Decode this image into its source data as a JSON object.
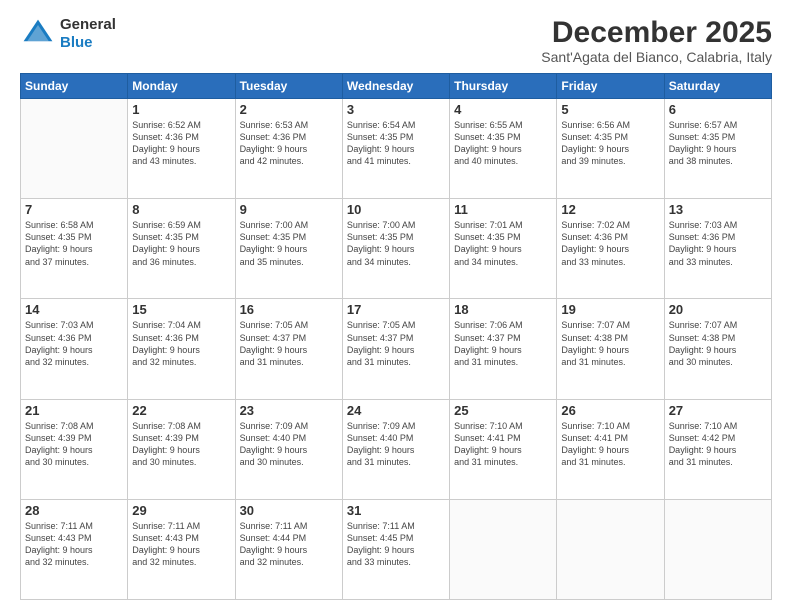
{
  "header": {
    "logo_line1": "General",
    "logo_line2": "Blue",
    "title": "December 2025",
    "subtitle": "Sant'Agata del Bianco, Calabria, Italy"
  },
  "days_of_week": [
    "Sunday",
    "Monday",
    "Tuesday",
    "Wednesday",
    "Thursday",
    "Friday",
    "Saturday"
  ],
  "weeks": [
    [
      {
        "day": "",
        "info": ""
      },
      {
        "day": "1",
        "info": "Sunrise: 6:52 AM\nSunset: 4:36 PM\nDaylight: 9 hours\nand 43 minutes."
      },
      {
        "day": "2",
        "info": "Sunrise: 6:53 AM\nSunset: 4:36 PM\nDaylight: 9 hours\nand 42 minutes."
      },
      {
        "day": "3",
        "info": "Sunrise: 6:54 AM\nSunset: 4:35 PM\nDaylight: 9 hours\nand 41 minutes."
      },
      {
        "day": "4",
        "info": "Sunrise: 6:55 AM\nSunset: 4:35 PM\nDaylight: 9 hours\nand 40 minutes."
      },
      {
        "day": "5",
        "info": "Sunrise: 6:56 AM\nSunset: 4:35 PM\nDaylight: 9 hours\nand 39 minutes."
      },
      {
        "day": "6",
        "info": "Sunrise: 6:57 AM\nSunset: 4:35 PM\nDaylight: 9 hours\nand 38 minutes."
      }
    ],
    [
      {
        "day": "7",
        "info": "Sunrise: 6:58 AM\nSunset: 4:35 PM\nDaylight: 9 hours\nand 37 minutes."
      },
      {
        "day": "8",
        "info": "Sunrise: 6:59 AM\nSunset: 4:35 PM\nDaylight: 9 hours\nand 36 minutes."
      },
      {
        "day": "9",
        "info": "Sunrise: 7:00 AM\nSunset: 4:35 PM\nDaylight: 9 hours\nand 35 minutes."
      },
      {
        "day": "10",
        "info": "Sunrise: 7:00 AM\nSunset: 4:35 PM\nDaylight: 9 hours\nand 34 minutes."
      },
      {
        "day": "11",
        "info": "Sunrise: 7:01 AM\nSunset: 4:35 PM\nDaylight: 9 hours\nand 34 minutes."
      },
      {
        "day": "12",
        "info": "Sunrise: 7:02 AM\nSunset: 4:36 PM\nDaylight: 9 hours\nand 33 minutes."
      },
      {
        "day": "13",
        "info": "Sunrise: 7:03 AM\nSunset: 4:36 PM\nDaylight: 9 hours\nand 33 minutes."
      }
    ],
    [
      {
        "day": "14",
        "info": "Sunrise: 7:03 AM\nSunset: 4:36 PM\nDaylight: 9 hours\nand 32 minutes."
      },
      {
        "day": "15",
        "info": "Sunrise: 7:04 AM\nSunset: 4:36 PM\nDaylight: 9 hours\nand 32 minutes."
      },
      {
        "day": "16",
        "info": "Sunrise: 7:05 AM\nSunset: 4:37 PM\nDaylight: 9 hours\nand 31 minutes."
      },
      {
        "day": "17",
        "info": "Sunrise: 7:05 AM\nSunset: 4:37 PM\nDaylight: 9 hours\nand 31 minutes."
      },
      {
        "day": "18",
        "info": "Sunrise: 7:06 AM\nSunset: 4:37 PM\nDaylight: 9 hours\nand 31 minutes."
      },
      {
        "day": "19",
        "info": "Sunrise: 7:07 AM\nSunset: 4:38 PM\nDaylight: 9 hours\nand 31 minutes."
      },
      {
        "day": "20",
        "info": "Sunrise: 7:07 AM\nSunset: 4:38 PM\nDaylight: 9 hours\nand 30 minutes."
      }
    ],
    [
      {
        "day": "21",
        "info": "Sunrise: 7:08 AM\nSunset: 4:39 PM\nDaylight: 9 hours\nand 30 minutes."
      },
      {
        "day": "22",
        "info": "Sunrise: 7:08 AM\nSunset: 4:39 PM\nDaylight: 9 hours\nand 30 minutes."
      },
      {
        "day": "23",
        "info": "Sunrise: 7:09 AM\nSunset: 4:40 PM\nDaylight: 9 hours\nand 30 minutes."
      },
      {
        "day": "24",
        "info": "Sunrise: 7:09 AM\nSunset: 4:40 PM\nDaylight: 9 hours\nand 31 minutes."
      },
      {
        "day": "25",
        "info": "Sunrise: 7:10 AM\nSunset: 4:41 PM\nDaylight: 9 hours\nand 31 minutes."
      },
      {
        "day": "26",
        "info": "Sunrise: 7:10 AM\nSunset: 4:41 PM\nDaylight: 9 hours\nand 31 minutes."
      },
      {
        "day": "27",
        "info": "Sunrise: 7:10 AM\nSunset: 4:42 PM\nDaylight: 9 hours\nand 31 minutes."
      }
    ],
    [
      {
        "day": "28",
        "info": "Sunrise: 7:11 AM\nSunset: 4:43 PM\nDaylight: 9 hours\nand 32 minutes."
      },
      {
        "day": "29",
        "info": "Sunrise: 7:11 AM\nSunset: 4:43 PM\nDaylight: 9 hours\nand 32 minutes."
      },
      {
        "day": "30",
        "info": "Sunrise: 7:11 AM\nSunset: 4:44 PM\nDaylight: 9 hours\nand 32 minutes."
      },
      {
        "day": "31",
        "info": "Sunrise: 7:11 AM\nSunset: 4:45 PM\nDaylight: 9 hours\nand 33 minutes."
      },
      {
        "day": "",
        "info": ""
      },
      {
        "day": "",
        "info": ""
      },
      {
        "day": "",
        "info": ""
      }
    ]
  ]
}
